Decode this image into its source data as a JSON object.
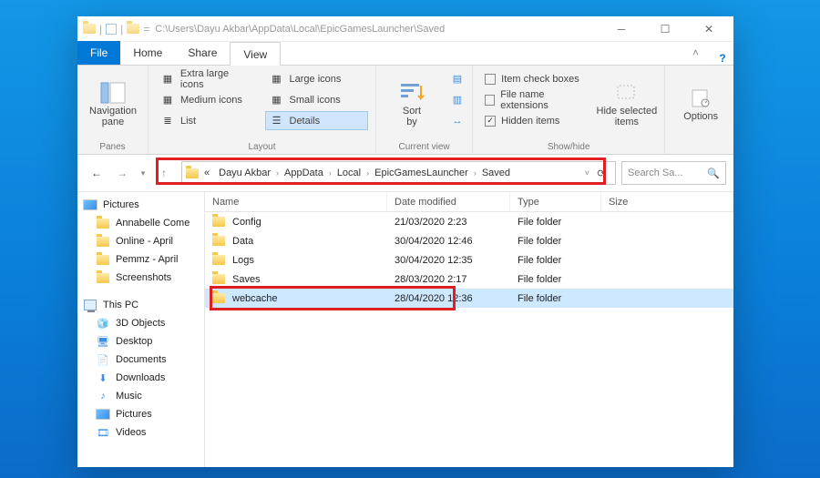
{
  "title_path": "C:\\Users\\Dayu Akbar\\AppData\\Local\\EpicGamesLauncher\\Saved",
  "tabs": {
    "file": "File",
    "home": "Home",
    "share": "Share",
    "view": "View"
  },
  "ribbon": {
    "panes": {
      "nav_pane": "Navigation\npane",
      "group": "Panes"
    },
    "layout": {
      "extra_large": "Extra large icons",
      "large": "Large icons",
      "medium": "Medium icons",
      "small": "Small icons",
      "list": "List",
      "details": "Details",
      "group": "Layout"
    },
    "current_view": {
      "sort_by": "Sort\nby",
      "group": "Current view"
    },
    "show_hide": {
      "item_check": "Item check boxes",
      "file_ext": "File name extensions",
      "hidden": "Hidden items",
      "hide_selected": "Hide selected\nitems",
      "group": "Show/hide"
    },
    "options": "Options"
  },
  "breadcrumb": [
    "«",
    "Dayu Akbar",
    "AppData",
    "Local",
    "EpicGamesLauncher",
    "Saved"
  ],
  "search_placeholder": "Search Sa...",
  "tree": {
    "pictures": "Pictures",
    "items": [
      "Annabelle Come",
      "Online - April",
      "Pemmz - April",
      "Screenshots"
    ],
    "this_pc": "This PC",
    "pc_items": [
      "3D Objects",
      "Desktop",
      "Documents",
      "Downloads",
      "Music",
      "Pictures",
      "Videos"
    ]
  },
  "columns": {
    "name": "Name",
    "date": "Date modified",
    "type": "Type",
    "size": "Size"
  },
  "rows": [
    {
      "name": "Config",
      "date": "21/03/2020 2:23",
      "type": "File folder"
    },
    {
      "name": "Data",
      "date": "30/04/2020 12:46",
      "type": "File folder"
    },
    {
      "name": "Logs",
      "date": "30/04/2020 12:35",
      "type": "File folder"
    },
    {
      "name": "Saves",
      "date": "28/03/2020 2:17",
      "type": "File folder"
    },
    {
      "name": "webcache",
      "date": "28/04/2020 12:36",
      "type": "File folder"
    }
  ]
}
